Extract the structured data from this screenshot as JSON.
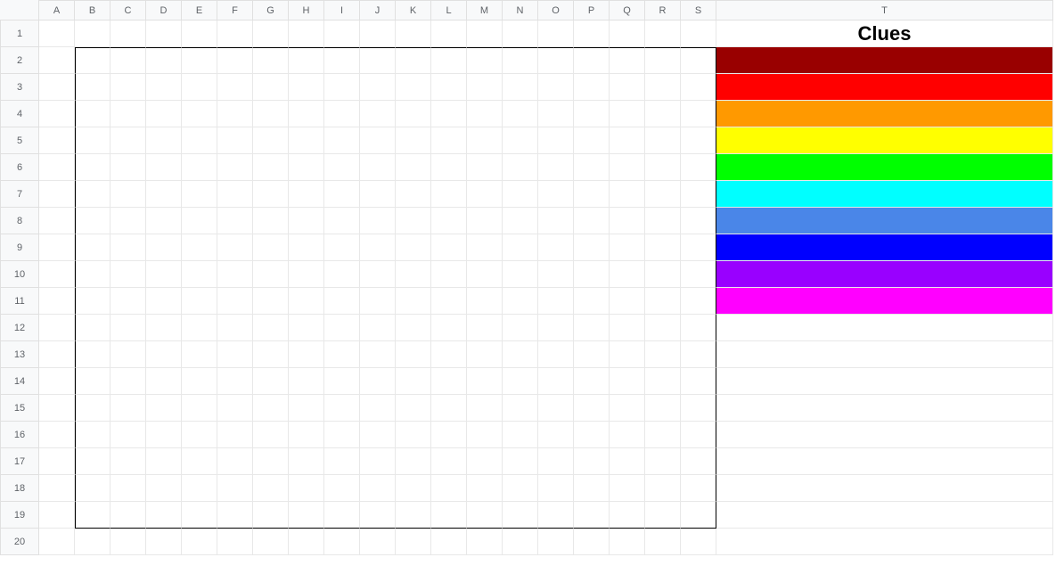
{
  "columns": [
    "A",
    "B",
    "C",
    "D",
    "E",
    "F",
    "G",
    "H",
    "I",
    "J",
    "K",
    "L",
    "M",
    "N",
    "O",
    "P",
    "Q",
    "R",
    "S",
    "T"
  ],
  "rows": [
    "1",
    "2",
    "3",
    "4",
    "5",
    "6",
    "7",
    "8",
    "9",
    "10",
    "11",
    "12",
    "13",
    "14",
    "15",
    "16",
    "17",
    "18",
    "19",
    "20"
  ],
  "rect": {
    "col_start": 2,
    "col_end": 19,
    "row_start": 2,
    "row_end": 19
  },
  "clues": {
    "title": "Clues",
    "colors": [
      "#990000",
      "#ff0000",
      "#ff9900",
      "#ffff00",
      "#00ff00",
      "#00ffff",
      "#4a86e8",
      "#0000ff",
      "#9900ff",
      "#ff00ff"
    ]
  }
}
